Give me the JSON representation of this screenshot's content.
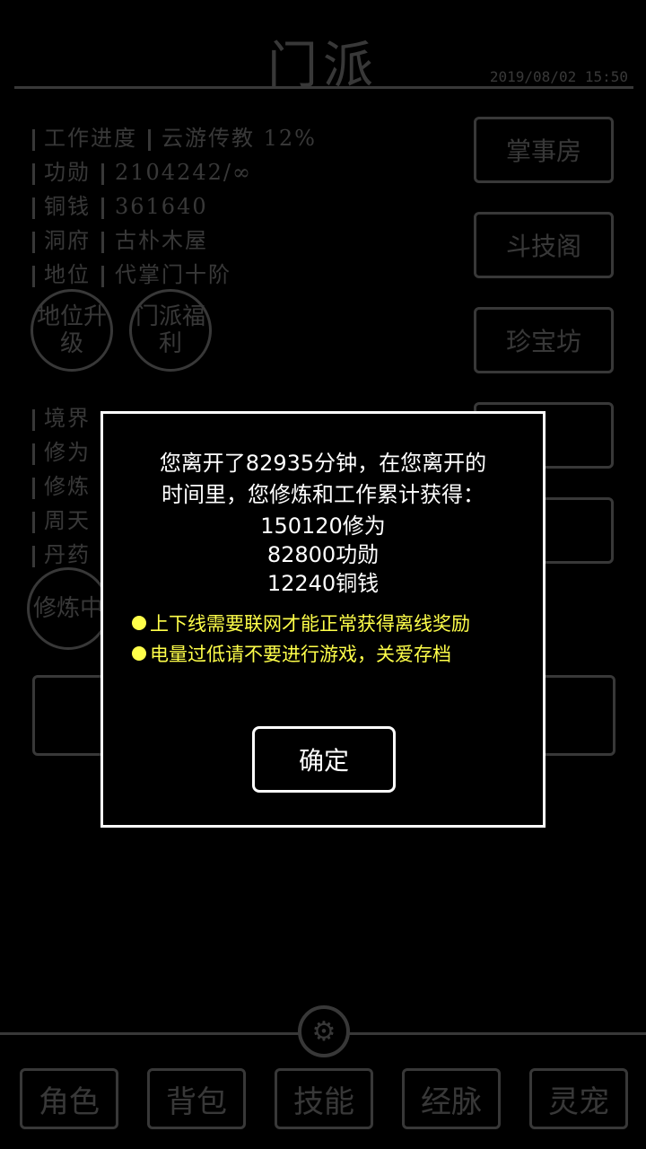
{
  "header": {
    "title": "门派",
    "timestamp": "2019/08/02 15:50"
  },
  "stats": [
    {
      "label": "工作进度",
      "value": "云游传教 12%"
    },
    {
      "label": "功勋",
      "value": "2104242/∞"
    },
    {
      "label": "铜钱",
      "value": "361640"
    },
    {
      "label": "洞府",
      "value": "古朴木屋"
    },
    {
      "label": "地位",
      "value": "代掌门十阶"
    }
  ],
  "circles": {
    "rank_up": "地位升级",
    "welfare": "门派福利",
    "cultivating": "修炼中"
  },
  "side_buttons": [
    "掌事房",
    "斗技阁",
    "珍宝坊"
  ],
  "stats2_labels": [
    "境界",
    "修为",
    "修炼",
    "周天",
    "丹药"
  ],
  "bottom_tabs": [
    "角色",
    "背包",
    "技能",
    "经脉",
    "灵宠"
  ],
  "dialog": {
    "line1": "您离开了82935分钟，在您离开的",
    "line2": "时间里，您修炼和工作累计获得：",
    "reward1": "150120修为",
    "reward2": "82800功勋",
    "reward3": "12240铜钱",
    "note1": "上下线需要联网才能正常获得离线奖励",
    "note2": "电量过低请不要进行游戏，关爱存档",
    "ok_label": "确定"
  },
  "colors": {
    "note": "#ffff4a",
    "background": "#000000",
    "line": "#ffffff"
  },
  "icons": {
    "settings": "gear-icon"
  }
}
